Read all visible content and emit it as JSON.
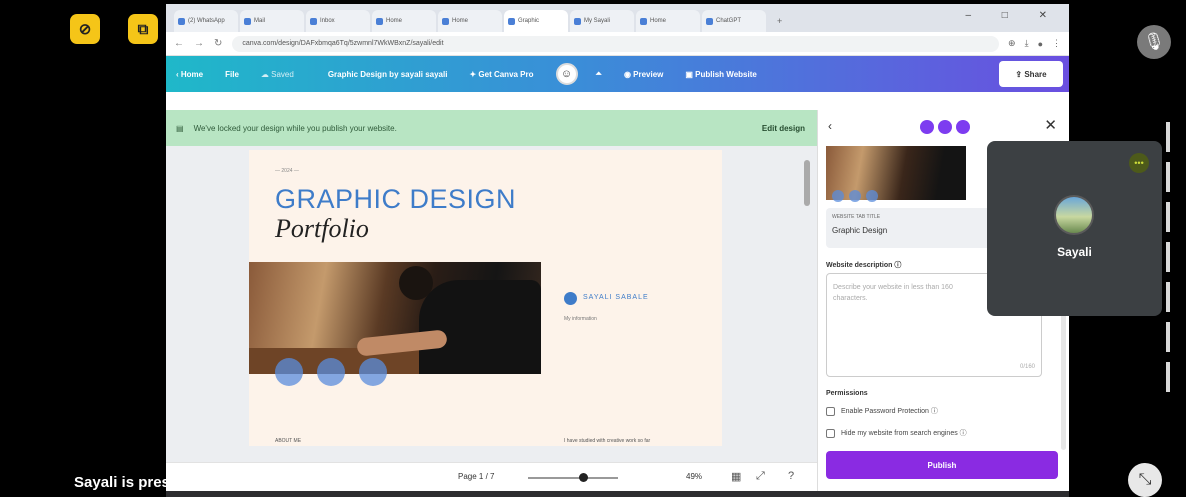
{
  "meeting": {
    "presenter_text": "Sayali is presenting",
    "participant_name": "Sayali"
  },
  "browser": {
    "tabs": [
      "(2) WhatsApp",
      "Mail",
      "Inbox",
      "Home",
      "Home",
      "Graphic",
      "My Sayali",
      "Home",
      "ChatGPT"
    ],
    "url": "canva.com/design/DAFxbmqa6Tq/5zwmnl7WkWBxnZ/sayali/edit"
  },
  "canva": {
    "home": "Home",
    "file": "File",
    "saved": "Saved",
    "design_title": "Graphic Design by sayali sayali",
    "get_pro": "Get Canva Pro",
    "preview": "Preview",
    "publish_website": "Publish Website",
    "share": "Share"
  },
  "notice": {
    "text": "We've locked your design while you publish your website.",
    "edit": "Edit design"
  },
  "page": {
    "small_label": "— 2024 —",
    "title": "GRAPHIC DESIGN",
    "subtitle": "Portfolio",
    "name": "SAYALI SABALE",
    "name_sub": "My information",
    "foot_left": "ABOUT ME",
    "foot_right": "I have studied with creative work so far"
  },
  "status": {
    "page": "Page 1 / 7",
    "zoom": "49%"
  },
  "panel": {
    "title_label": "WEBSITE TAB TITLE",
    "title_value": "Graphic Design",
    "desc_label": "Website description",
    "desc_placeholder": "Describe your website in less than 160 characters.",
    "desc_count": "0/160",
    "permissions_label": "Permissions",
    "password_label": "Enable Password Protection",
    "hide_label": "Hide my website from search engines",
    "publish": "Publish"
  }
}
